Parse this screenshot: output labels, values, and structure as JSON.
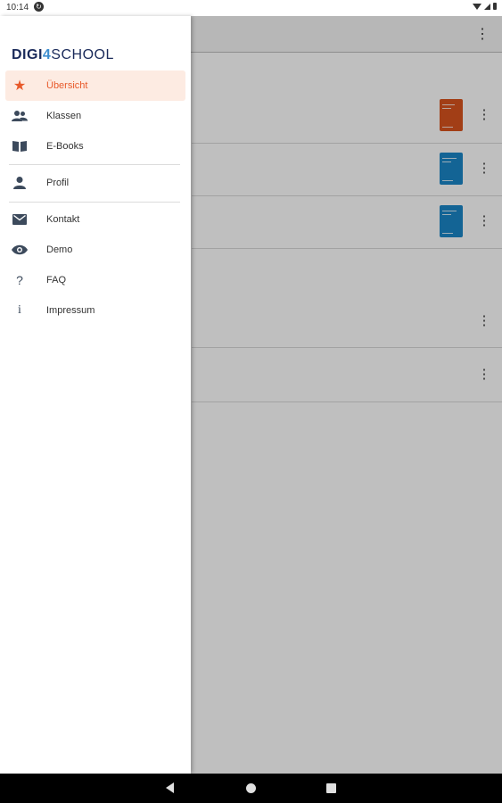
{
  "status_bar": {
    "time": "10:14"
  },
  "drawer": {
    "logo": {
      "part1": "DIGI",
      "part2": "4",
      "part3": "SCHOOL"
    },
    "items": [
      {
        "label": "Übersicht",
        "icon": "star-icon",
        "active": true
      },
      {
        "label": "Klassen",
        "icon": "people-icon",
        "active": false
      },
      {
        "label": "E-Books",
        "icon": "book-icon",
        "active": false
      },
      {
        "label": "Profil",
        "icon": "person-icon",
        "active": false
      },
      {
        "label": "Kontakt",
        "icon": "mail-icon",
        "active": false
      },
      {
        "label": "Demo",
        "icon": "eye-icon",
        "active": false
      },
      {
        "label": "FAQ",
        "icon": "question-icon",
        "active": false
      },
      {
        "label": "Impressum",
        "icon": "info-icon",
        "active": false
      }
    ]
  },
  "colors": {
    "accent": "#e8592a",
    "active_bg": "#fdebe2",
    "brand_dark": "#1a2a5a",
    "brand_blue": "#3d8ecf",
    "book_orange": "#d9531e",
    "book_blue": "#1a86c7"
  }
}
